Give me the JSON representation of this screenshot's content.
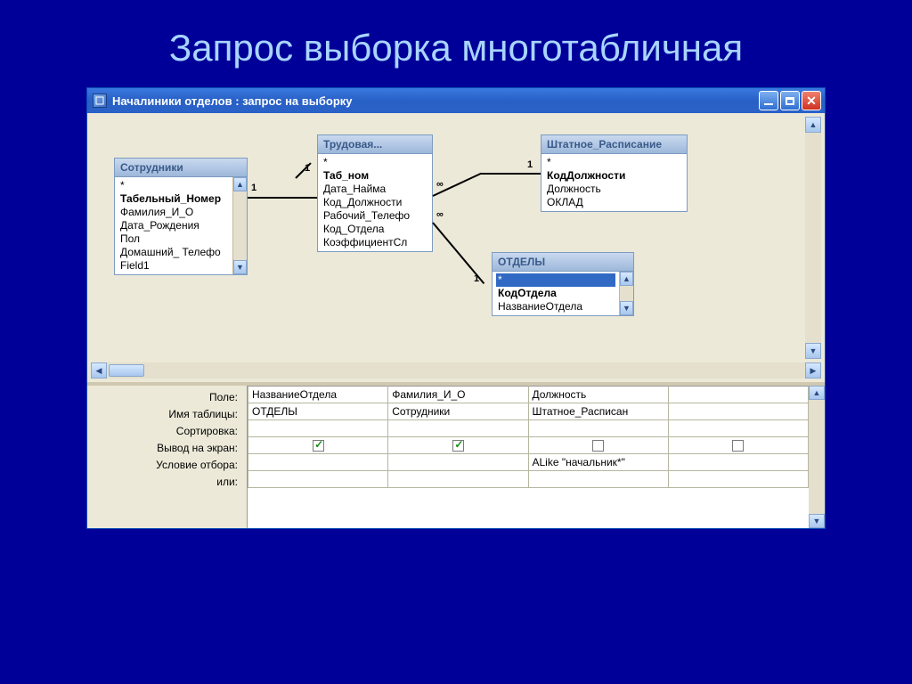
{
  "slide_title": "Запрос выборка многотабличная",
  "window_title": "Началиники отделов : запрос на выборку",
  "tables": {
    "employees": {
      "title": "Сотрудники",
      "fields": [
        "*",
        "Табельный_Номер",
        "Фамилия_И_О",
        "Дата_Рождения",
        "Пол",
        "Домашний_ Телефо",
        "Field1"
      ],
      "bold_idx": 1
    },
    "labor": {
      "title": "Трудовая...",
      "fields": [
        "*",
        "Таб_ном",
        "Дата_Найма",
        "Код_Должности",
        "Рабочий_Телефо",
        "Код_Отдела",
        "КоэффициентСл"
      ],
      "bold_idx": 1
    },
    "schedule": {
      "title": "Штатное_Расписание",
      "fields": [
        "*",
        "КодДолжности",
        "Должность",
        "ОКЛАД"
      ],
      "bold_idx": 1
    },
    "depts": {
      "title": "ОТДЕЛЫ",
      "fields": [
        "*",
        "КодОтдела",
        "НазваниеОтдела"
      ],
      "bold_idx": 1,
      "selected_idx": 0
    }
  },
  "relations": {
    "r1": {
      "left_card": "1",
      "right_card": "1"
    },
    "r2": {
      "left_card": "∞",
      "right_card": "1"
    },
    "r3": {
      "left_card": "∞",
      "right_card": "1"
    }
  },
  "grid_labels": {
    "field": "Поле:",
    "table": "Имя таблицы:",
    "sort": "Сортировка:",
    "show": "Вывод на экран:",
    "criteria": "Условие отбора:",
    "or": "или:"
  },
  "grid_cols": [
    {
      "field": "НазваниеОтдела",
      "table": "ОТДЕЛЫ",
      "show": true,
      "criteria": ""
    },
    {
      "field": "Фамилия_И_О",
      "table": "Сотрудники",
      "show": true,
      "criteria": ""
    },
    {
      "field": "Должность",
      "table": "Штатное_Расписан",
      "show": false,
      "criteria": "ALike \"начальник*\""
    },
    {
      "field": "",
      "table": "",
      "show": false,
      "criteria": ""
    }
  ]
}
